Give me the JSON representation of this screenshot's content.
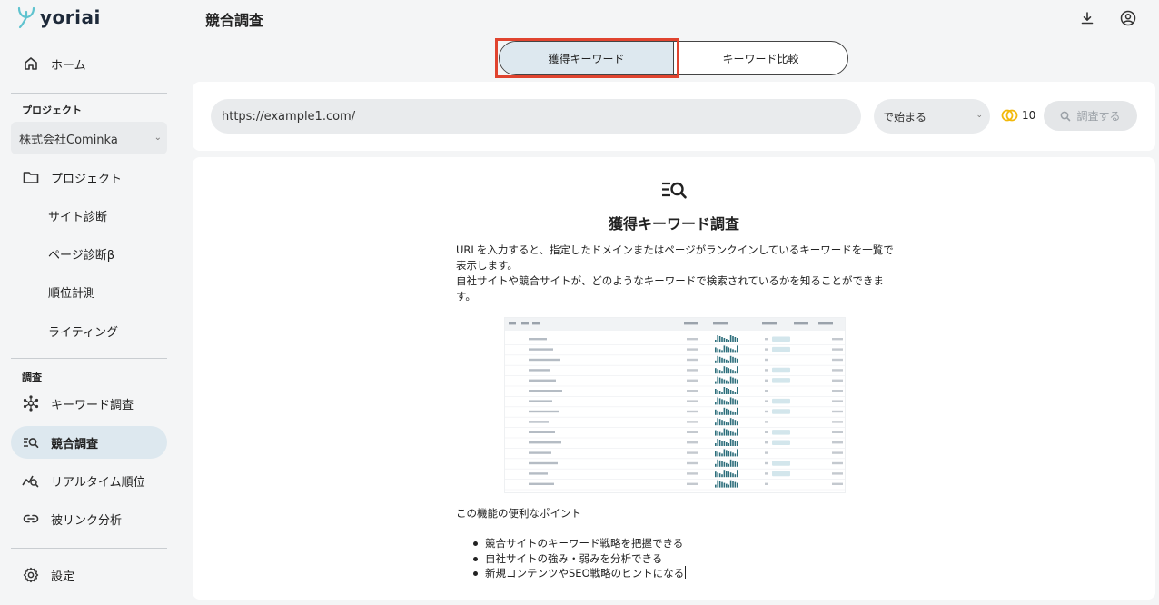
{
  "brand": {
    "name": "yoriai"
  },
  "sidebar": {
    "home": "ホーム",
    "project_section": "プロジェクト",
    "project_select": "株式会社Cominka",
    "project_items": [
      "プロジェクト",
      "サイト診断",
      "ページ診断β",
      "順位計測",
      "ライティング"
    ],
    "research_section": "調査",
    "research_items": [
      "キーワード調査",
      "競合調査",
      "リアルタイム順位",
      "被リンク分析"
    ],
    "settings": "設定"
  },
  "header": {
    "title": "競合調査"
  },
  "tabs": [
    {
      "label": "獲得キーワード",
      "active": true
    },
    {
      "label": "キーワード比較",
      "active": false
    }
  ],
  "search": {
    "url_value": "https://example1.com/",
    "match_option": "で始まる",
    "credits": "10",
    "button": "調査する"
  },
  "content": {
    "title": "獲得キーワード調査",
    "description": "URLを入力すると、指定したドメインまたはページがランクインしているキーワードを一覧で表示します。\n自社サイトや競合サイトが、どのようなキーワードで検索されているかを知ることができます。",
    "points_title": "この機能の便利なポイント",
    "points": [
      "競合サイトのキーワード戦略を把握できる",
      "自社サイトの強み・弱みを分析できる",
      "新規コンテンツやSEO戦略のヒントになる"
    ]
  },
  "colors": {
    "accent": "#dde8ef",
    "highlight": "#e0442f",
    "bg": "#f4f5f6",
    "credit": "#f2b90c"
  }
}
